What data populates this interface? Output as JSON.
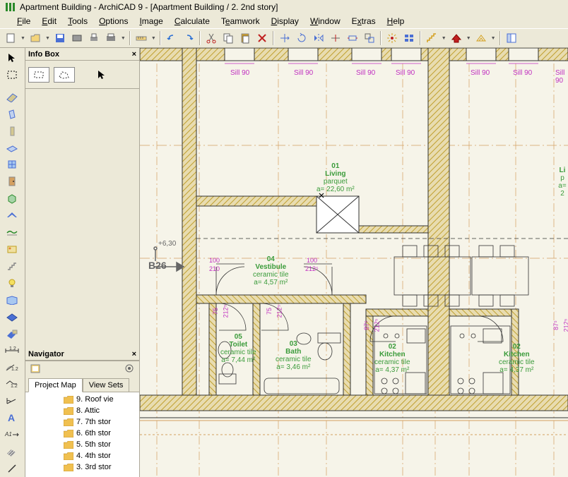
{
  "title": "Apartment Building - ArchiCAD 9 - [Apartment Building / 2. 2nd story]",
  "menu": [
    "File",
    "Edit",
    "Tools",
    "Options",
    "Image",
    "Calculate",
    "Teamwork",
    "Display",
    "Window",
    "Extras",
    "Help"
  ],
  "panels": {
    "infobox": "Info Box",
    "navigator": "Navigator"
  },
  "nav_tabs": [
    "Project Map",
    "View Sets"
  ],
  "nav_tree": [
    "9. Roof vie",
    "8. Attic",
    "7. 7th stor",
    "6. 6th stor",
    "5. 5th stor",
    "4. 4th stor",
    "3. 3rd stor"
  ],
  "rooms": {
    "living": {
      "num": "01",
      "name": "Living",
      "mat": "parquet",
      "area": "a= 22,60 m²"
    },
    "vestibule": {
      "num": "04",
      "name": "Vestibule",
      "mat": "ceramic tile",
      "area": "a= 4,57 m²"
    },
    "toilet": {
      "num": "05",
      "name": "Toilet",
      "mat": "ceramic tile",
      "area": "a= 7,44 m²"
    },
    "bath": {
      "num": "03",
      "name": "Bath",
      "mat": "ceramic tile",
      "area": "a= 3,46 m²"
    },
    "kitchen1": {
      "num": "02",
      "name": "Kitchen",
      "mat": "ceramic tile",
      "area": "a= 4,37 m²"
    },
    "kitchen2": {
      "num": "02",
      "name": "Kitchen",
      "mat": "ceramic tile",
      "area": "a= 4,37 m²"
    },
    "living2": {
      "num": "Li",
      "name": "p",
      "mat": "",
      "area": "a= 2"
    }
  },
  "dims": {
    "d100a": "100",
    "d210": "210",
    "d100b": "100",
    "d2125a": "212⁵",
    "d75a": "75",
    "d2125b": "212⁵",
    "d75b": "75",
    "d2125c": "212⁵",
    "d875a": "87⁵",
    "d2125d": "212⁵",
    "d875b": "87⁵",
    "d2125e": "212⁵"
  },
  "sills": [
    "Sill 90",
    "Sill 90",
    "Sill 90",
    "Sill 90",
    "Sill 90",
    "Sill 90",
    "Sill 90"
  ],
  "labels": {
    "b26": "B26",
    "elev": "+6,30"
  }
}
